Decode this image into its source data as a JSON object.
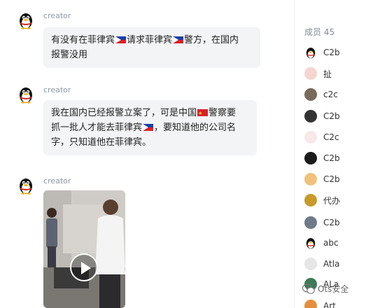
{
  "messages": [
    {
      "sender": "creator",
      "line1_a": "有没有在菲律宾",
      "line1_b": "请求菲律宾",
      "line1_c": "警方，在国内",
      "line2": "报警没用"
    },
    {
      "sender": "creator",
      "line1_a": "我在国内已经报警立案了，可是中国",
      "line1_b": "警察要",
      "line2_a": "抓一批人才能去菲律宾",
      "line2_b": "，要知道他的公司名",
      "line3": "字，只知道他在菲律宾。"
    },
    {
      "sender": "creator",
      "type": "video"
    }
  ],
  "members": {
    "header": "成员 45",
    "items": [
      {
        "name": "C2b",
        "avatar": "penguin-avatar",
        "color": "#000000"
      },
      {
        "name": "扯",
        "avatar": "anime-avatar",
        "color": "#f5d5d0"
      },
      {
        "name": "c2c",
        "avatar": "photo-avatar",
        "color": "#7a6a5a"
      },
      {
        "name": "C2b",
        "avatar": "panda-avatar",
        "color": "#333333"
      },
      {
        "name": "C2c",
        "avatar": "text-avatar",
        "color": "#f7e9e9"
      },
      {
        "name": "C2b",
        "avatar": "dark-avatar",
        "color": "#1b1b1b"
      },
      {
        "name": "C2b",
        "avatar": "cartoon-avatar",
        "color": "#f0c27b"
      },
      {
        "name": "代办",
        "avatar": "gold-avatar",
        "color": "#c79a2a"
      },
      {
        "name": "C2b",
        "avatar": "figure-avatar",
        "color": "#6e7b88"
      },
      {
        "name": "abc",
        "avatar": "penguin-avatar",
        "color": "#000000"
      },
      {
        "name": "Atla",
        "avatar": "sketch-avatar",
        "color": "#e6e6e6"
      },
      {
        "name": "ALa",
        "avatar": "green-avatar",
        "color": "#3d7a56"
      },
      {
        "name": "Art",
        "avatar": "orange-avatar",
        "color": "#e58f3c"
      }
    ]
  },
  "watermark": "Ots安全"
}
